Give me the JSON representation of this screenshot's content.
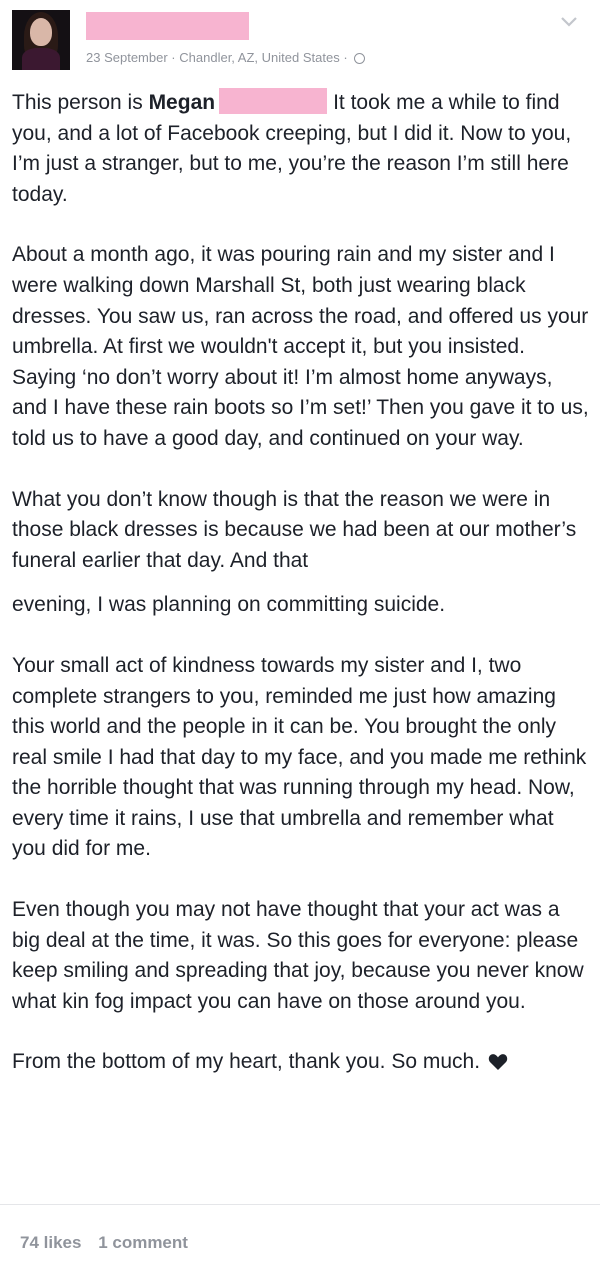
{
  "post": {
    "date": "23 September",
    "location": "Chandler, AZ, United States",
    "separator": "·",
    "privacy_icon": "globe-icon",
    "menu_icon": "chevron-down-icon",
    "paragraphs": {
      "p1_intro": "This person is ",
      "p1_name": "Megan",
      "p1_rest": "It took me a while to find you, and a lot of Facebook creeping, but I did it. Now to you, I’m just a stranger, but to me, you’re the reason I’m still here today.",
      "p2": "About a month ago, it was pouring rain and my sister and I were walking down Marshall St, both just wearing black dresses. You saw us, ran across the road, and offered us your umbrella. At first we wouldn't accept it, but you insisted. Saying ‘no don’t worry about it! I’m almost home anyways, and I have these rain boots so I’m set!’ Then you gave it to us, told us to have a good day, and continued on your way.",
      "p3": "What you don’t know though is that the reason we were in those black dresses is because we had been at our mother’s funeral earlier that day. And that",
      "p3b": "evening, I was planning on committing suicide.",
      "p4": "Your small act of kindness towards my sister and I, two complete strangers to you, reminded me just how amazing this world and the people in it can be. You brought the only real smile I had that day to my face, and you made me rethink the horrible thought that was running through my head. Now, every time it rains, I use that umbrella and remember what you did for me.",
      "p5": "Even though you may not have thought that your act was a big deal at the time, it was. So this goes for everyone: please keep smiling and spreading that joy, because you never know what kin fog impact you can have on those around you.",
      "p6": "From the bottom of my heart, thank you. So much."
    },
    "heart_icon": "heart-icon"
  },
  "footer": {
    "likes": "74 likes",
    "comments": "1 comment"
  },
  "colors": {
    "redaction": "#f7b4d0",
    "meta_text": "#90949c",
    "body_text": "#1d2129"
  }
}
